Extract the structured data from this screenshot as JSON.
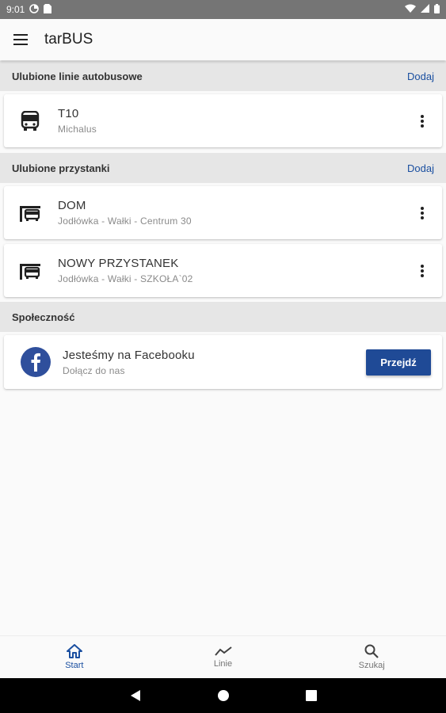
{
  "status_bar": {
    "time": "9:01"
  },
  "app_bar": {
    "title": "tarBUS"
  },
  "sections": {
    "lines": {
      "title": "Ulubione linie autobusowe",
      "action": "Dodaj",
      "items": [
        {
          "title": "T10",
          "subtitle": "Michalus"
        }
      ]
    },
    "stops": {
      "title": "Ulubione przystanki",
      "action": "Dodaj",
      "items": [
        {
          "title": "DOM",
          "subtitle": "Jodłówka - Wałki - Centrum 30"
        },
        {
          "title": "NOWY PRZYSTANEK",
          "subtitle": "Jodłówka - Wałki - SZKOŁA`02"
        }
      ]
    },
    "community": {
      "title": "Społeczność",
      "card": {
        "title": "Jesteśmy na Facebooku",
        "subtitle": "Dołącz do nas",
        "button": "Przejdź"
      }
    }
  },
  "bottom_nav": {
    "items": [
      {
        "label": "Start",
        "icon": "home-icon",
        "active": true
      },
      {
        "label": "Linie",
        "icon": "trending-line-icon",
        "active": false
      },
      {
        "label": "Szukaj",
        "icon": "search-icon",
        "active": false
      }
    ]
  },
  "colors": {
    "accent": "#1a4fa0",
    "button": "#1f4a96",
    "facebook": "#2f4f9c",
    "section_bg": "#e6e6e6"
  }
}
